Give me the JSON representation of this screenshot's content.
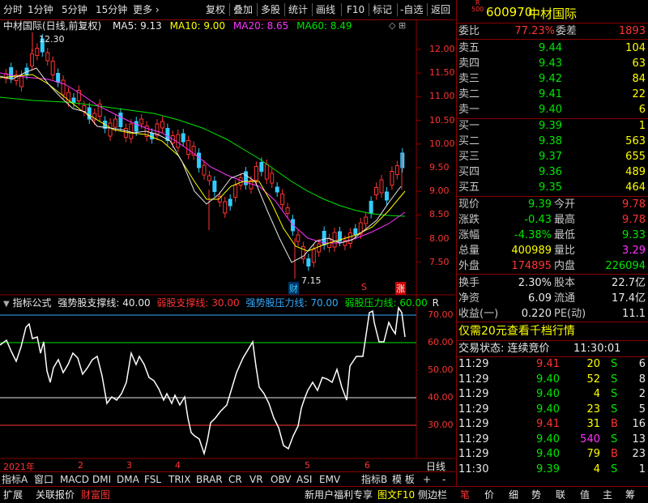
{
  "toolbar": {
    "items": [
      "分时",
      "1分钟",
      "5分钟",
      "15分钟",
      "更多 ›",
      "复权",
      "叠加",
      "多股",
      "统计",
      "画线",
      "F10",
      "标记",
      "-自选",
      "返回"
    ]
  },
  "chart": {
    "title": "中材国际(日线,前复权)",
    "ma": [
      {
        "label": "MA5: 9.13",
        "color": "#e8e8e8"
      },
      {
        "label": "MA10: 9.00",
        "color": "#ffff00"
      },
      {
        "label": "MA20: 8.65",
        "color": "#ff33ff"
      },
      {
        "label": "MA60: 8.49",
        "color": "#00e600"
      }
    ],
    "high_label": "12.30",
    "low_label": "7.15",
    "marker_cai": "财",
    "marker_s": "S",
    "marker_zhang": "涨",
    "price_axis": [
      "12.00",
      "11.50",
      "11.00",
      "10.50",
      "10.00",
      "9.50",
      "9.00",
      "8.50",
      "8.00",
      "7.50"
    ],
    "indicator_title": "指标公式",
    "indicator_lines": [
      {
        "label": "强势股支撑线: 40.00",
        "color": "#e8e8e8"
      },
      {
        "label": "弱股支撑线: 30.00",
        "color": "#ff3333"
      },
      {
        "label": "强势股压力线: 70.00",
        "color": "#33aaff"
      },
      {
        "label": "弱股压力线: 60.00",
        "color": "#00e600"
      }
    ],
    "indicator_r": "R",
    "indicator_axis": [
      "70.00",
      "60.00",
      "50.00",
      "40.00",
      "30.00"
    ],
    "date_axis": [
      "2021年",
      "2",
      "3",
      "4",
      "5",
      "6"
    ],
    "day_line_btn": "日线"
  },
  "tabs": [
    "指标A",
    "窗口",
    "MACD",
    "DMI",
    "DMA",
    "FSL",
    "TRIX",
    "BRAR",
    "CR",
    "VR",
    "OBV",
    "ASI",
    "EMV",
    "指标B",
    "模 板",
    "+",
    "-"
  ],
  "status": {
    "left": [
      "扩展",
      "关联报价",
      "财富图"
    ],
    "promo": "新用户福利专享",
    "tuwen": "图文F10",
    "sidebar": "侧边栏",
    "right_tabs": [
      "笔",
      "价",
      "细",
      "势",
      "联",
      "值",
      "主",
      "筹"
    ]
  },
  "stock": {
    "badge_top": "R",
    "badge_bottom": "500",
    "code": "600970",
    "name": "中材国际"
  },
  "weibi": {
    "label": "委比",
    "value": "77.23%",
    "label2": "委差",
    "value2": "1893"
  },
  "sell": [
    {
      "label": "卖五",
      "price": "9.44",
      "vol": "104"
    },
    {
      "label": "卖四",
      "price": "9.43",
      "vol": "63"
    },
    {
      "label": "卖三",
      "price": "9.42",
      "vol": "84"
    },
    {
      "label": "卖二",
      "price": "9.41",
      "vol": "22"
    },
    {
      "label": "卖一",
      "price": "9.40",
      "vol": "6"
    }
  ],
  "buy": [
    {
      "label": "买一",
      "price": "9.39",
      "vol": "1"
    },
    {
      "label": "买二",
      "price": "9.38",
      "vol": "563"
    },
    {
      "label": "买三",
      "price": "9.37",
      "vol": "655"
    },
    {
      "label": "买四",
      "price": "9.36",
      "vol": "489"
    },
    {
      "label": "买五",
      "price": "9.35",
      "vol": "464"
    }
  ],
  "quote": [
    {
      "l1": "现价",
      "v1": "9.39",
      "c1": "green",
      "l2": "今开",
      "v2": "9.78",
      "c2": "red"
    },
    {
      "l1": "涨跌",
      "v1": "-0.43",
      "c1": "green",
      "l2": "最高",
      "v2": "9.78",
      "c2": "red"
    },
    {
      "l1": "涨幅",
      "v1": "-4.38%",
      "c1": "green",
      "l2": "最低",
      "v2": "9.33",
      "c2": "green"
    },
    {
      "l1": "总量",
      "v1": "400989",
      "c1": "yellow",
      "l2": "量比",
      "v2": "3.29",
      "c2": "magenta"
    },
    {
      "l1": "外盘",
      "v1": "174895",
      "c1": "red",
      "l2": "内盘",
      "v2": "226094",
      "c2": "green"
    }
  ],
  "quote2": [
    {
      "l1": "换手",
      "v1": "2.30%",
      "l2": "股本",
      "v2": "22.7亿"
    },
    {
      "l1": "净资",
      "v1": "6.09",
      "l2": "流通",
      "v2": "17.4亿"
    },
    {
      "l1": "收益(一)",
      "v1": "0.220",
      "l2": "PE(动)",
      "v2": "11.1"
    }
  ],
  "promo_text": "仅需20元查看千档行情",
  "trade_status": {
    "label": "交易状态: 连续竞价",
    "time": "11:30:01"
  },
  "trades": [
    {
      "time": "11:29",
      "price": "9.41",
      "pc": "red",
      "vol": "20",
      "vc": "yellow",
      "bs": "S",
      "bc": "green",
      "n": "6"
    },
    {
      "time": "11:29",
      "price": "9.40",
      "pc": "green",
      "vol": "52",
      "vc": "yellow",
      "bs": "S",
      "bc": "green",
      "n": "8"
    },
    {
      "time": "11:29",
      "price": "9.40",
      "pc": "green",
      "vol": "4",
      "vc": "yellow",
      "bs": "S",
      "bc": "green",
      "n": "2"
    },
    {
      "time": "11:29",
      "price": "9.40",
      "pc": "green",
      "vol": "23",
      "vc": "yellow",
      "bs": "S",
      "bc": "green",
      "n": "5"
    },
    {
      "time": "11:29",
      "price": "9.41",
      "pc": "red",
      "vol": "31",
      "vc": "yellow",
      "bs": "B",
      "bc": "red",
      "n": "16"
    },
    {
      "time": "11:29",
      "price": "9.40",
      "pc": "green",
      "vol": "540",
      "vc": "magenta",
      "bs": "S",
      "bc": "green",
      "n": "13"
    },
    {
      "time": "11:29",
      "price": "9.40",
      "pc": "green",
      "vol": "79",
      "vc": "yellow",
      "bs": "B",
      "bc": "red",
      "n": "23"
    },
    {
      "time": "11:30",
      "price": "9.39",
      "pc": "green",
      "vol": "4",
      "vc": "yellow",
      "bs": "S",
      "bc": "green",
      "n": "1"
    }
  ]
}
